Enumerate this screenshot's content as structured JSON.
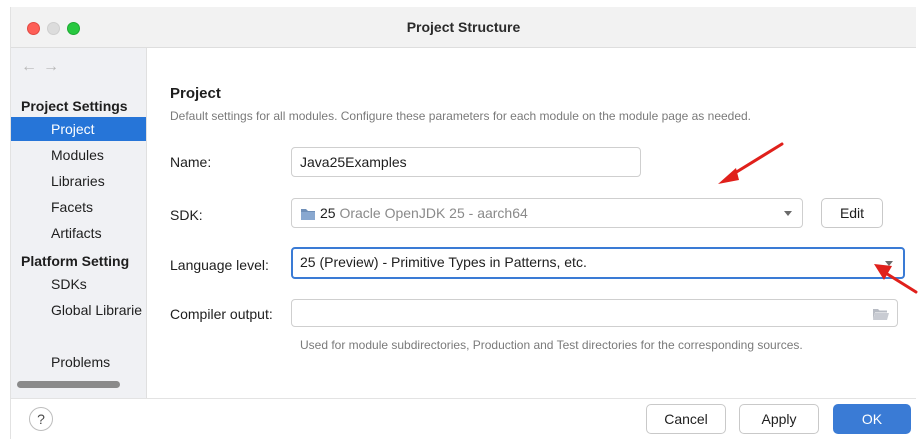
{
  "window": {
    "title": "Project Structure"
  },
  "nav": {
    "back": "←",
    "forward": "→"
  },
  "sidebar": {
    "project_settings_header": "Project Settings",
    "project_items": [
      "Project",
      "Modules",
      "Libraries",
      "Facets",
      "Artifacts"
    ],
    "platform_settings_header": "Platform Setting",
    "platform_items": [
      "SDKs",
      "Global Librarie"
    ],
    "problems": "Problems",
    "selected": "Project"
  },
  "main": {
    "heading": "Project",
    "description": "Default settings for all modules. Configure these parameters for each module on the module page as needed.",
    "name_label": "Name:",
    "name_value": "Java25Examples",
    "sdk_label": "SDK:",
    "sdk_version": "25",
    "sdk_name": "Oracle OpenJDK 25 - aarch64",
    "sdk_edit_label": "Edit",
    "language_label": "Language level:",
    "language_value": "25 (Preview) - Primitive Types in Patterns, etc.",
    "compiler_label": "Compiler output:",
    "compiler_value": "",
    "compiler_hint": "Used for module subdirectories, Production and Test directories for the corresponding sources."
  },
  "footer": {
    "help": "?",
    "cancel": "Cancel",
    "apply": "Apply",
    "ok": "OK"
  },
  "colors": {
    "accent": "#3a7bd5",
    "selection": "#2675d8",
    "annotation_arrow": "#e0201b"
  },
  "icons": [
    "back-arrow-icon",
    "forward-arrow-icon",
    "sdk-folder-icon",
    "chevron-down-icon",
    "folder-open-icon",
    "help-icon"
  ]
}
